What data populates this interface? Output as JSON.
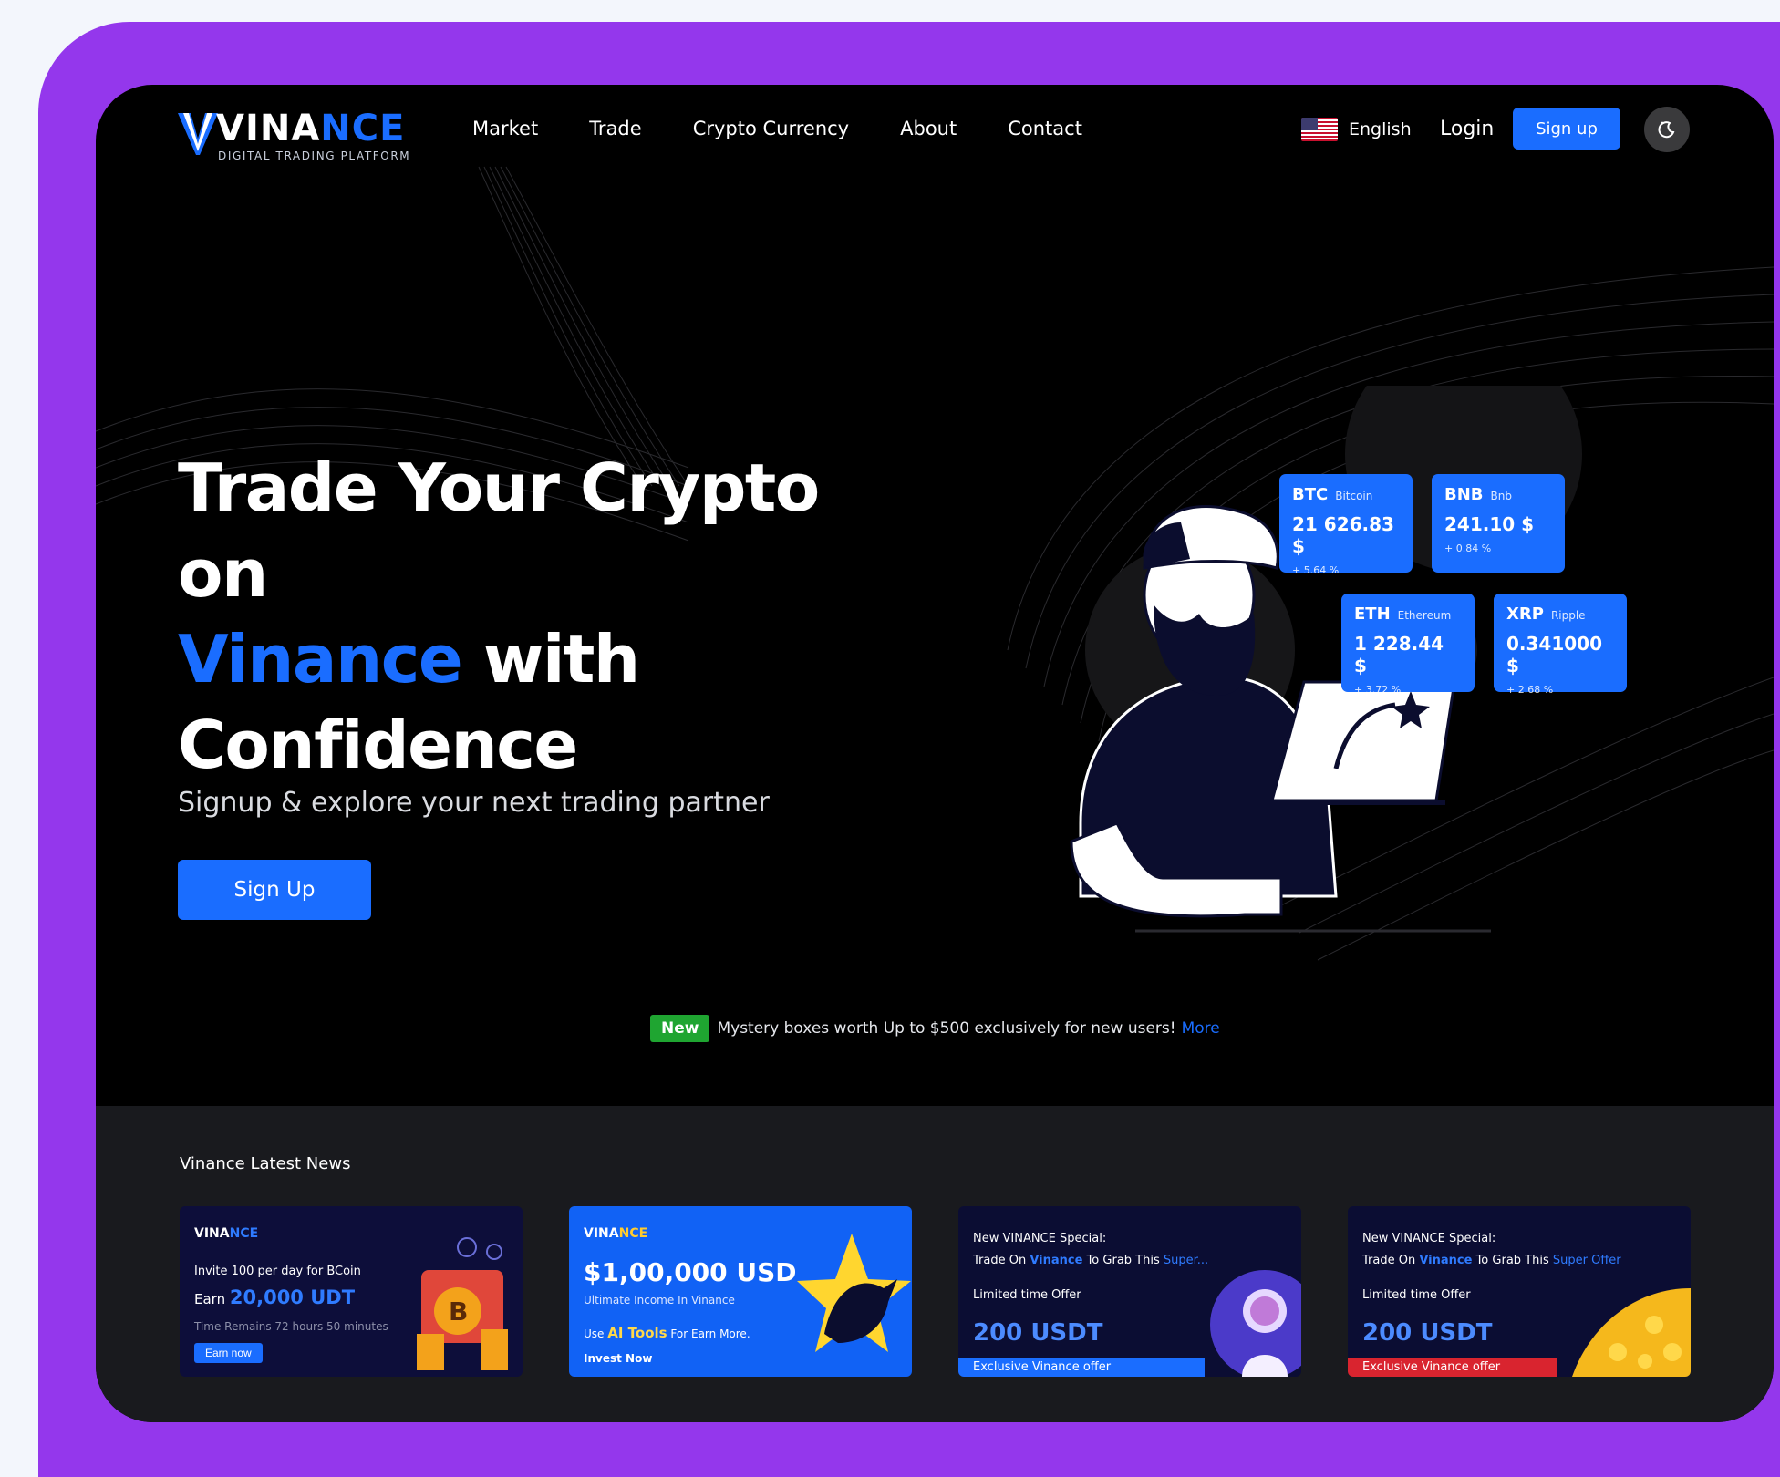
{
  "brand": {
    "name_part1": "VINA",
    "name_part2": "NCE",
    "tagline": "DIGITAL TRADING PLATFORM"
  },
  "nav": {
    "links": [
      "Market",
      "Trade",
      "Crypto Currency",
      "About",
      "Contact"
    ],
    "language": "English",
    "login": "Login",
    "signup": "Sign up",
    "theme_icon": "moon-icon"
  },
  "hero": {
    "title_line1": "Trade Your Crypto on",
    "title_highlight": "Vinance",
    "title_after": " with",
    "title_line3": "Confidence",
    "subtitle": "Signup & explore your next trading partner",
    "cta": "Sign Up"
  },
  "tickers": [
    {
      "symbol": "BTC",
      "name": "Bitcoin",
      "price": "21 626.83 $",
      "change": "+ 5.64 %"
    },
    {
      "symbol": "BNB",
      "name": "Bnb",
      "price": "241.10 $",
      "change": "+ 0.84 %"
    },
    {
      "symbol": "ETH",
      "name": "Ethereum",
      "price": "1 228.44 $",
      "change": "+ 3.72 %"
    },
    {
      "symbol": "XRP",
      "name": "Ripple",
      "price": "0.341000 $",
      "change": "+ 2.68 %"
    }
  ],
  "promo": {
    "badge": "New",
    "text": "Mystery boxes worth Up to $500 exclusively for new users!",
    "link": "More"
  },
  "news": {
    "title": "Vinance Latest News",
    "cards": [
      {
        "line1": "Invite 100 per day for BCoin",
        "earn_prefix": "Earn",
        "earn_value": "20,000 UDT",
        "line3": "Time Remains 72 hours 50 minutes",
        "button": "Earn now"
      },
      {
        "big": "$1,00,000 USD",
        "line2": "Ultimate Income In Vinance",
        "line3_prefix": "Use",
        "line3_highlight": "AI Tools",
        "line3_suffix": "For Earn More.",
        "line4": "Invest Now"
      },
      {
        "line1": "New VINANCE Special:",
        "line2_prefix": "Trade On",
        "line2_brand": "Vinance",
        "line2_mid": "To Grab This",
        "line2_highlight": "Super...",
        "line3": "Limited time Offer",
        "big": "200 USDT",
        "foot": "Exclusive Vinance offer"
      },
      {
        "line1": "New VINANCE Special:",
        "line2_prefix": "Trade On",
        "line2_brand": "Vinance",
        "line2_mid": "To Grab This",
        "line2_highlight": "Super Offer",
        "line3": "Limited time Offer",
        "big": "200 USDT",
        "foot": "Exclusive Vinance offer"
      }
    ]
  },
  "colors": {
    "accent": "#1a6dff",
    "frame": "#9437ec",
    "new_badge": "#1fa531"
  }
}
